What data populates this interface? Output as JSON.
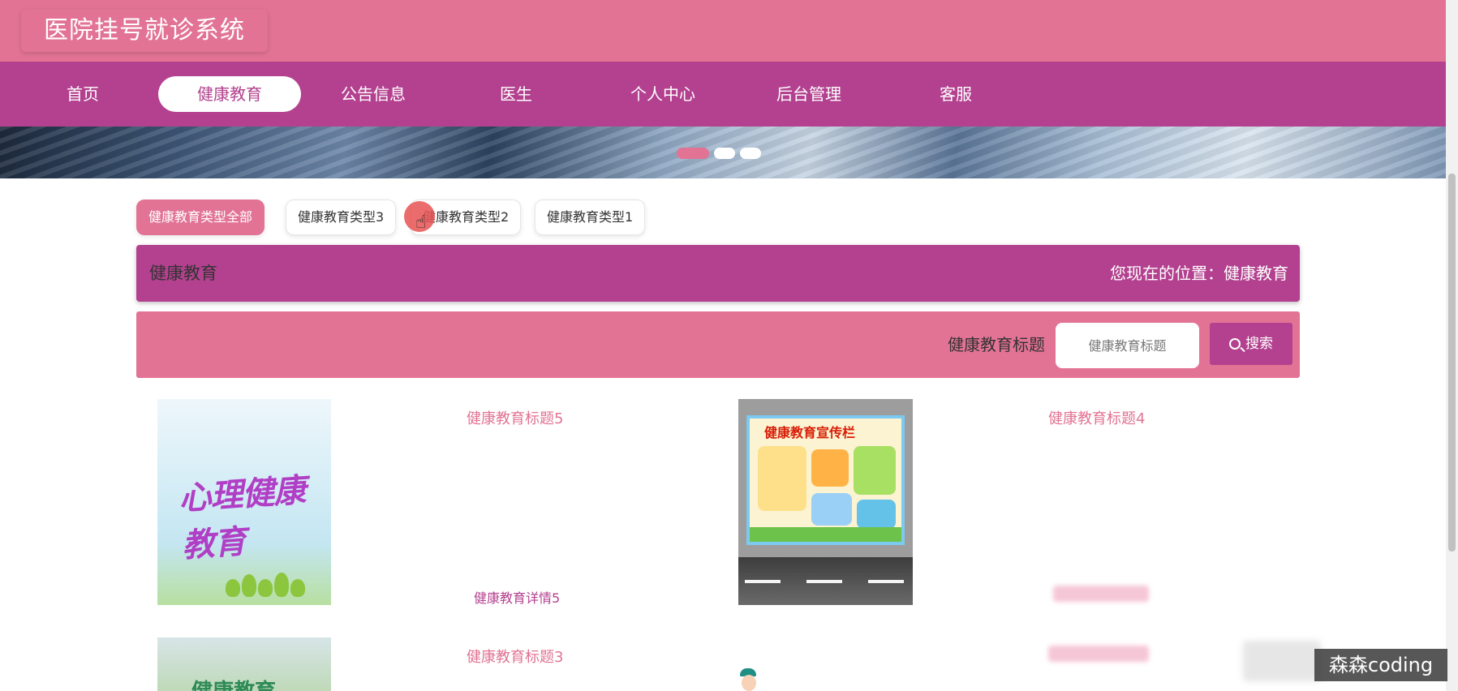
{
  "app": {
    "title": "医院挂号就诊系统"
  },
  "nav": {
    "items": [
      {
        "label": "首页",
        "active": false
      },
      {
        "label": "健康教育",
        "active": true
      },
      {
        "label": "公告信息",
        "active": false
      },
      {
        "label": "医生",
        "active": false
      },
      {
        "label": "个人中心",
        "active": false
      },
      {
        "label": "后台管理",
        "active": false
      },
      {
        "label": "客服",
        "active": false
      }
    ]
  },
  "banner": {
    "active_dot": 1,
    "dot_count": 3
  },
  "categories": [
    {
      "label": "健康教育类型全部",
      "active": true
    },
    {
      "label": "健康教育类型3",
      "active": false
    },
    {
      "label": "健康教育类型2",
      "active": false
    },
    {
      "label": "健康教育类型1",
      "active": false
    }
  ],
  "breadcrumb": {
    "title": "健康教育",
    "location": "您现在的位置：健康教育"
  },
  "search": {
    "label": "健康教育标题",
    "placeholder": "健康教育标题",
    "button_label": "搜索"
  },
  "cards": [
    {
      "title": "健康教育标题5",
      "detail": "健康教育详情5",
      "image_text": "心理健康教育"
    },
    {
      "title": "健康教育标题4",
      "detail": "",
      "image_text": "健康教育宣传栏"
    },
    {
      "title": "健康教育标题3",
      "detail": "",
      "image_text": "健康教育"
    }
  ],
  "watermark": "森森coding",
  "colors": {
    "primary_pink": "#e27394",
    "primary_purple": "#b3418f",
    "white": "#ffffff"
  }
}
